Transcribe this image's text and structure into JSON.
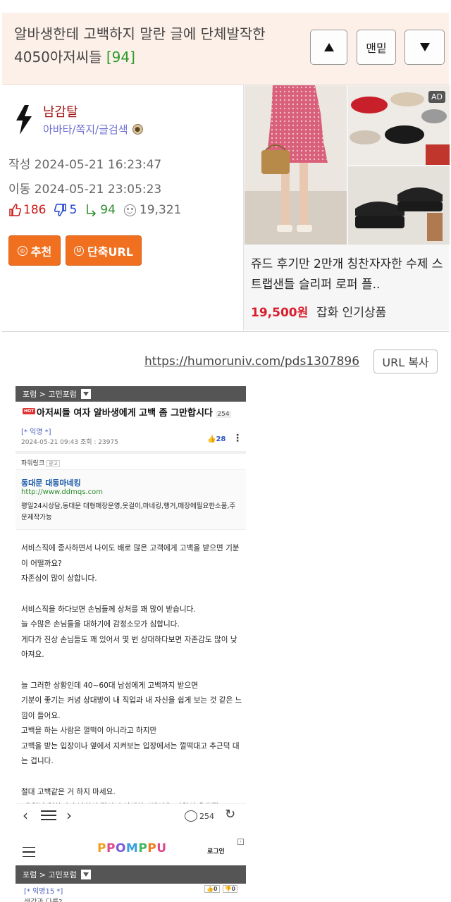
{
  "post": {
    "title": "알바생한테 고백하지 말란 글에 단체발작한 4050아저씨들",
    "comment_count": "[94]",
    "nav_up_label": "",
    "nav_bottom_label": "맨밑",
    "nav_down_label": ""
  },
  "author": {
    "name": "남감탈",
    "links": "아바타/쪽지/글검색",
    "written_label": "작성",
    "written_at": "2024-05-21 16:23:47",
    "moved_label": "이동",
    "moved_at": "2024-05-21 23:05:23"
  },
  "stats": {
    "up": "186",
    "down": "5",
    "share": "94",
    "views": "19,321"
  },
  "actions": {
    "recommend": "추천",
    "short_url": "단축URL"
  },
  "ad": {
    "badge": "AD",
    "title": "쥬드 후기만 2만개 칭찬자자한 수제 스트랩샌들 슬리퍼 로퍼 플..",
    "price": "19,500원",
    "category": "잡화 인기상품"
  },
  "url_row": {
    "url": "https://humoruniv.com/pds1307896",
    "copy_label": "URL 복사"
  },
  "embedded": {
    "breadcrumb": "포럼 > 고민포럼",
    "hot_label": "HOT",
    "title": "아저씨들 여자 알바생에게 고백 좀 그만합시다",
    "title_count": "254",
    "author": "[* 익명 *]",
    "date_views": "2024-05-21 09:43  조회 : 23975",
    "likes": "28",
    "powerlink": "파워링크",
    "powerlink_ad": "광고",
    "ad_name": "동대문 대동마네킹",
    "ad_url": "http://www.ddmqs.com",
    "ad_desc": "평일24시상담,동대문 대형매장운영,옷걸이,마네킹,행거,매장에필요한소품,주문제작가능",
    "body": [
      "서비스직에 종사하면서 나이도 배로 많은 고객에게 고백을 받으면 기분이 어떨까요?",
      "자존심이 많이 상합니다.",
      "",
      "서비스직을 하다보면 손님들께 상처를 꽤 많이 받습니다.",
      "늘 수많은 손님들을 대하기에 감정소모가 심합니다.",
      "게다가 진상 손님들도 꽤 있어서 몇 번 상대하다보면 자존감도 많이 낮아져요.",
      "",
      "늘 그러한 상황인데 40~60대 남성에게 고백까지 받으면",
      "기분이 좋기는 커녕 상대방이 내 직업과 내 자신을 쉽게 보는 것 같은 느낌이 들어요.",
      "고백을 하는 사람은 껄떡이 아니라고 하지만",
      "고백을 받는 입장이나 옆에서 지켜보는 입장에서는 껄떡대고 추근덕 대는 겁니다.",
      "",
      "절대 고백같은 거 하지 마세요.",
      "\"혹일날 일하셔서 남친이 많이 속상해하시겠어요\"따위의 유도질"
    ],
    "toolbar_comments": "254",
    "logo": "PPOMPPU",
    "login": "로그인",
    "breadcrumb2": "포럼 > 고민포럼",
    "row2_author": "[* 익명15 *]",
    "row2_up": "0",
    "row2_down": "0",
    "row2_text": "생각과 다름?"
  },
  "colors": {
    "title_bg": "#fdf0e8",
    "accent_orange": "#f07020",
    "count_green": "#2a9a2a",
    "author_red": "#a01010",
    "price_red": "#d81e2e"
  }
}
